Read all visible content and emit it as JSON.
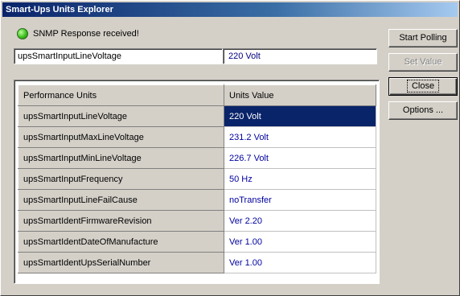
{
  "window": {
    "title": "Smart-Ups Units Explorer"
  },
  "status": {
    "led": "green-status-led",
    "text": "SNMP Response received!"
  },
  "selected_oid": "upsSmartInputLineVoltage",
  "selected_value": "220 Volt",
  "table": {
    "headers": {
      "name": "Performance Units",
      "value": "Units Value"
    },
    "rows": [
      {
        "name": "upsSmartInputLineVoltage",
        "value": "220 Volt"
      },
      {
        "name": "upsSmartInputMaxLineVoltage",
        "value": "231.2 Volt"
      },
      {
        "name": "upsSmartInputMinLineVoltage",
        "value": "226.7 Volt"
      },
      {
        "name": "upsSmartInputFrequency",
        "value": "50 Hz"
      },
      {
        "name": "upsSmartInputLineFailCause",
        "value": "noTransfer"
      },
      {
        "name": "upsSmartIdentFirmwareRevision",
        "value": "Ver 2.20"
      },
      {
        "name": "upsSmartIdentDateOfManufacture",
        "value": "Ver 1.00"
      },
      {
        "name": "upsSmartIdentUpsSerialNumber",
        "value": "Ver 1.00"
      }
    ]
  },
  "buttons": {
    "start_polling": "Start Polling",
    "set_value": "Set Value",
    "close": "Close",
    "options": "Options ..."
  },
  "colors": {
    "selection": "#0a246a",
    "value_text": "#0000a0",
    "face": "#d4d0c8"
  }
}
